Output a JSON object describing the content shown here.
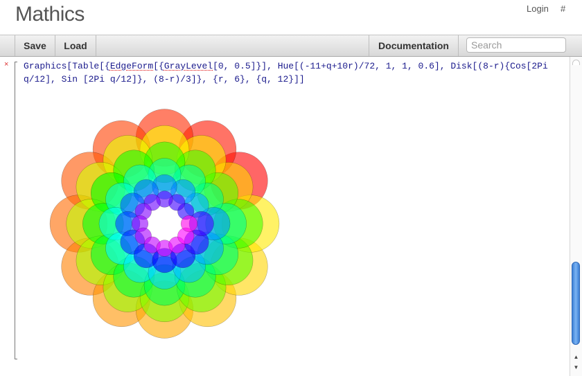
{
  "header": {
    "app_title": "Mathics",
    "login": "Login",
    "hash": "#"
  },
  "toolbar": {
    "save": "Save",
    "load": "Load",
    "documentation": "Documentation",
    "search_placeholder": "Search"
  },
  "cell": {
    "close": "×",
    "code_parts": [
      "Graphics[Table[{",
      "EdgeForm",
      "[{",
      "GrayLevel",
      "[0, 0.5]}], Hue[(-11+q+10r)/72, 1, 1, 0.6], Disk[(8-r){Cos[2Pi q/12], Sin [2Pi q/12]}, (8-r)/3]}, {r, 6}, {q, 12}]]"
    ]
  },
  "output": {
    "r_range": [
      1,
      6
    ],
    "q_range": [
      1,
      12
    ],
    "hue_alpha": 0.6,
    "edge_gray": 0
  },
  "scrollbar": {
    "up_arrow": "▲",
    "down_arrow": "▼"
  }
}
